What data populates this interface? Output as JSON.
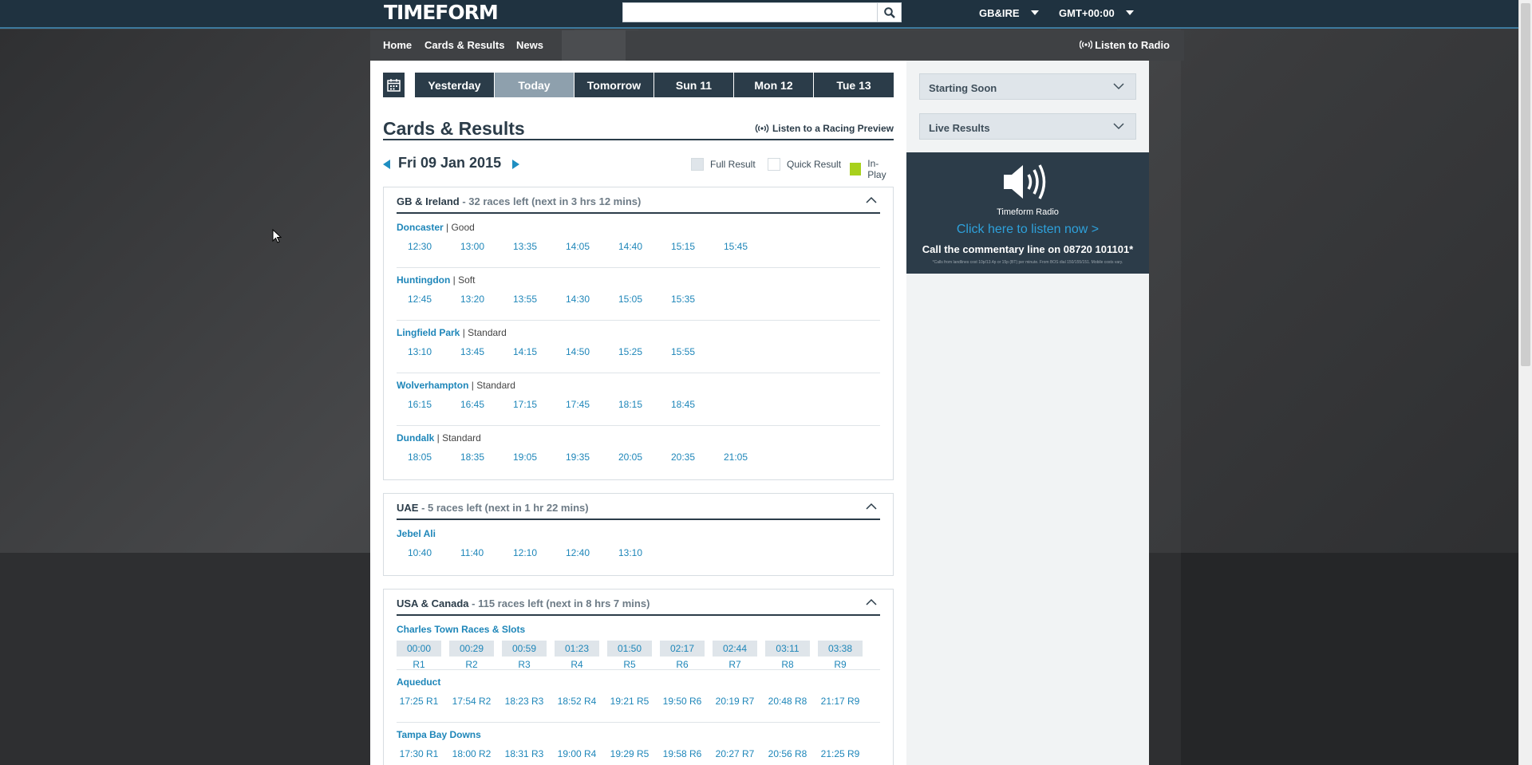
{
  "header": {
    "logo": "TIMEFORM",
    "search": {
      "value": "",
      "placeholder": ""
    },
    "region": "GB&IRE",
    "timezone": "GMT+00:00"
  },
  "nav": {
    "items": [
      "Home",
      "Cards & Results",
      "News"
    ],
    "radio": "Listen to Radio"
  },
  "datebar": {
    "tabs": [
      "Yesterday",
      "Today",
      "Tomorrow",
      "Sun 11",
      "Mon 12",
      "Tue 13"
    ],
    "active": "Today"
  },
  "main": {
    "title": "Cards & Results",
    "preview_link": "Listen to a Racing Preview",
    "date": "Fri 09 Jan 2015",
    "legend": [
      "Full Result",
      "Quick Result",
      "In-Play"
    ]
  },
  "colors": {
    "full_result": "#dfe5ea",
    "quick_result": "#ffffff",
    "in_play": "#a8d11c"
  },
  "regions": [
    {
      "name": "GB & Ireland",
      "summary": " - 32 races left (next in 3 hrs 12 mins)",
      "meetings": [
        {
          "name": "Doncaster",
          "going": " | Good",
          "times": [
            "12:30",
            "13:00",
            "13:35",
            "14:05",
            "14:40",
            "15:15",
            "15:45"
          ]
        },
        {
          "name": "Huntingdon",
          "going": " | Soft",
          "times": [
            "12:45",
            "13:20",
            "13:55",
            "14:30",
            "15:05",
            "15:35"
          ]
        },
        {
          "name": "Lingfield Park",
          "going": " | Standard",
          "times": [
            "13:10",
            "13:45",
            "14:15",
            "14:50",
            "15:25",
            "15:55"
          ]
        },
        {
          "name": "Wolverhampton",
          "going": " | Standard",
          "times": [
            "16:15",
            "16:45",
            "17:15",
            "17:45",
            "18:15",
            "18:45"
          ]
        },
        {
          "name": "Dundalk",
          "going": " | Standard",
          "times": [
            "18:05",
            "18:35",
            "19:05",
            "19:35",
            "20:05",
            "20:35",
            "21:05"
          ]
        }
      ]
    },
    {
      "name": "UAE",
      "summary": " - 5 races left (next in 1 hr 22 mins)",
      "meetings": [
        {
          "name": "Jebel Ali",
          "going": "",
          "times": [
            "10:40",
            "11:40",
            "12:10",
            "12:40",
            "13:10"
          ]
        }
      ]
    },
    {
      "name": "USA & Canada",
      "summary": " - 115 races left (next in 8 hrs 7 mins)",
      "meetings": [
        {
          "name": "Charles Town Races & Slots",
          "going": "",
          "boxed": true,
          "times": [
            "00:00 R1",
            "00:29 R2",
            "00:59 R3",
            "01:23 R4",
            "01:50 R5",
            "02:17 R6",
            "02:44 R7",
            "03:11 R8",
            "03:38 R9"
          ]
        },
        {
          "name": "Aqueduct",
          "going": "",
          "times": [
            "17:25 R1",
            "17:54 R2",
            "18:23 R3",
            "18:52 R4",
            "19:21 R5",
            "19:50 R6",
            "20:19 R7",
            "20:48 R8",
            "21:17 R9"
          ]
        },
        {
          "name": "Tampa Bay Downs",
          "going": "",
          "times": [
            "17:30 R1",
            "18:00 R2",
            "18:31 R3",
            "19:00 R4",
            "19:29 R5",
            "19:58 R6",
            "20:27 R7",
            "20:56 R8",
            "21:25 R9"
          ]
        }
      ]
    }
  ],
  "sidebar": {
    "accordions": [
      "Starting Soon",
      "Live Results"
    ],
    "radio": {
      "name": "Timeform Radio",
      "cta": "Click here to listen now >",
      "call": "Call the commentary line on 08720 101101*",
      "fine_print": "*Calls from landlines cost 10p/13.4p or 15p (BT) per minute. From BOS dial 150/155/151. Mobile costs vary."
    }
  }
}
